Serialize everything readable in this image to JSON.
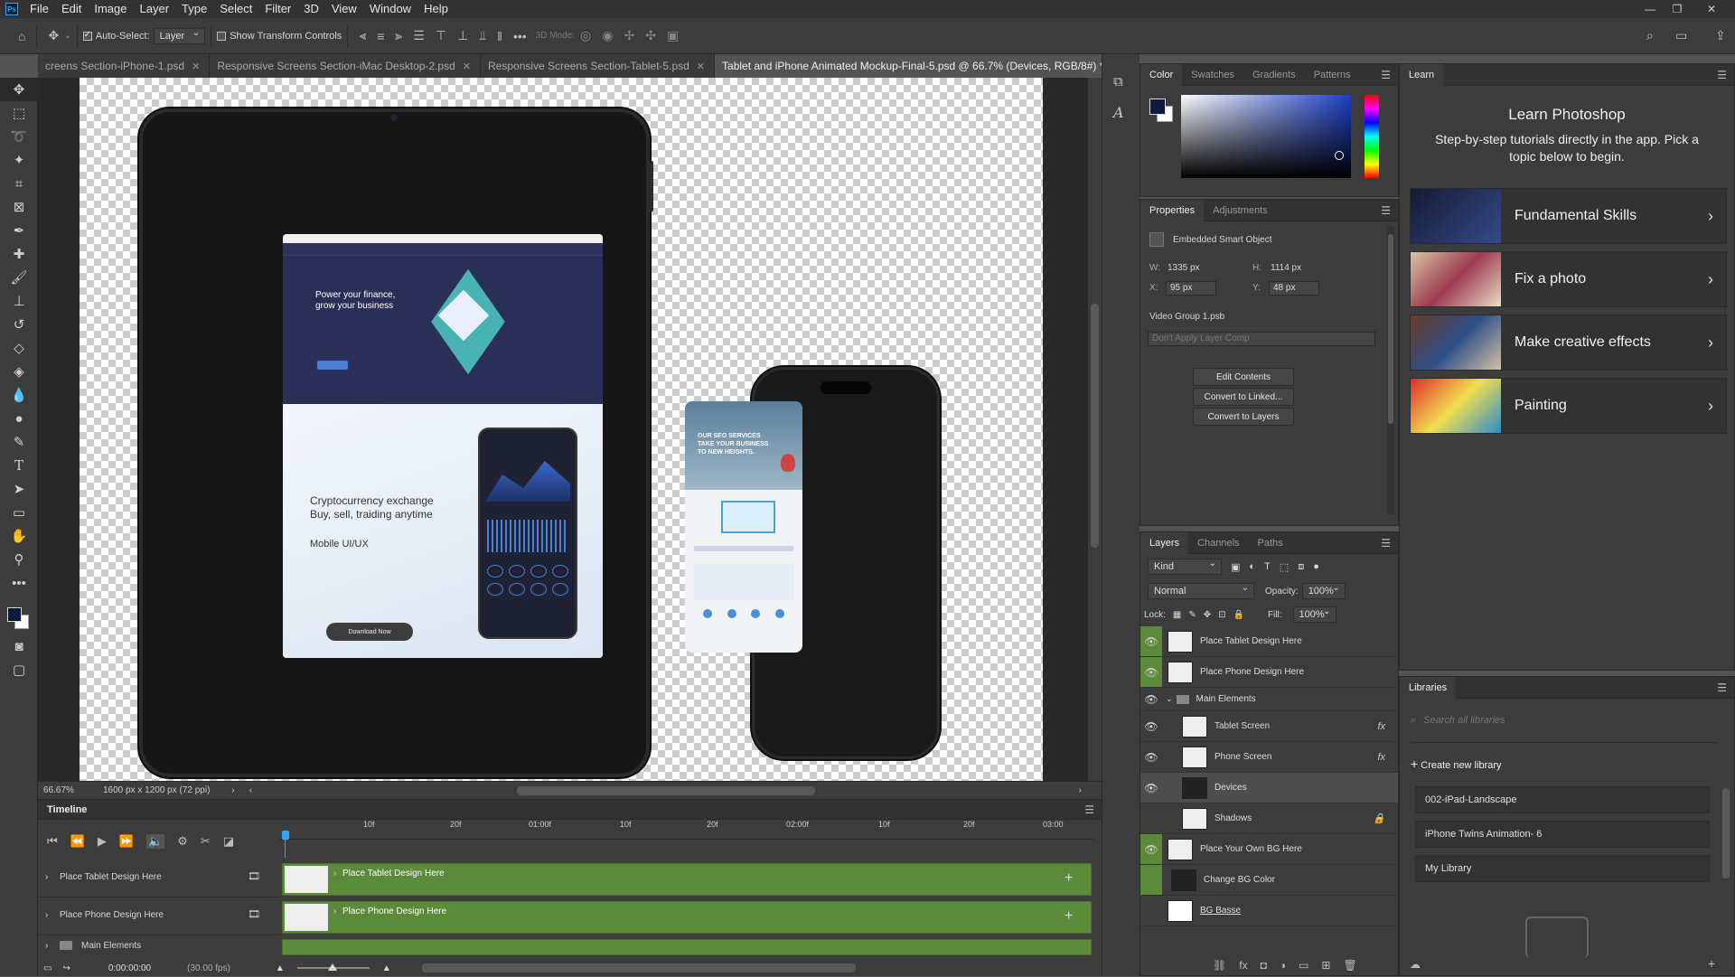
{
  "app": {
    "logo": "Ps"
  },
  "menu": [
    "File",
    "Edit",
    "Image",
    "Layer",
    "Type",
    "Select",
    "Filter",
    "3D",
    "View",
    "Window",
    "Help"
  ],
  "options": {
    "auto_select_label": "Auto-Select:",
    "auto_select_value": "Layer",
    "show_transform": "Show Transform Controls",
    "mode_3d": "3D Mode:"
  },
  "tabs": [
    {
      "label": "creens Section-iPhone-1.psd",
      "active": false
    },
    {
      "label": "Responsive Screens Section-iMac Desktop-2.psd",
      "active": false
    },
    {
      "label": "Responsive Screens Section-Tablet-5.psd",
      "active": false
    },
    {
      "label": "Tablet and iPhone Animated Mockup-Final-5.psd @ 66.7% (Devices, RGB/8#) *",
      "active": true
    }
  ],
  "tablet_site": {
    "hero_line1": "Power your finance,",
    "hero_line2": "grow your business",
    "crypto_line1": "Cryptocurrency exchange",
    "crypto_line2": "Buy, sell, traiding anytime",
    "app_sub": "Mobile UI/UX",
    "download": "Download Now"
  },
  "phone_site": {
    "line1": "OUR SEO SERVICES",
    "line2": "TAKE YOUR BUSINESS",
    "line3": "TO NEW HEIGHTS."
  },
  "status": {
    "zoom": "66.67%",
    "doc_info": "1600 px x 1200 px (72 ppi)"
  },
  "timeline": {
    "title": "Timeline",
    "ruler": [
      "10f",
      "20f",
      "01:00f",
      "10f",
      "20f",
      "02:00f",
      "10f",
      "20f",
      "03:00"
    ],
    "tracks": [
      {
        "label": "Place Tablet Design Here",
        "clip": "Place Tablet Design Here"
      },
      {
        "label": "Place Phone Design Here",
        "clip": "Place Phone Design Here"
      }
    ],
    "group": "Main Elements",
    "time": "0:00:00:00",
    "fps": "(30.00 fps)"
  },
  "color_panel": {
    "tabs": [
      "Color",
      "Swatches",
      "Gradients",
      "Patterns"
    ],
    "fg": "#0d1b3e",
    "bg": "#ffffff"
  },
  "properties": {
    "tabs": [
      "Properties",
      "Adjustments"
    ],
    "type": "Embedded Smart Object",
    "w_label": "W:",
    "w": "1335 px",
    "h_label": "H:",
    "h": "1114 px",
    "x_label": "X:",
    "x": "95 px",
    "y_label": "Y:",
    "y": "48 px",
    "file": "Video Group 1.psb",
    "layer_comp": "Don't Apply Layer Comp",
    "buttons": [
      "Edit Contents",
      "Convert to Linked...",
      "Convert to Layers"
    ]
  },
  "layers_panel": {
    "tabs": [
      "Layers",
      "Channels",
      "Paths"
    ],
    "kind": "Kind",
    "blend": "Normal",
    "opacity_label": "Opacity:",
    "opacity": "100%",
    "lock_label": "Lock:",
    "fill_label": "Fill:",
    "fill": "100%",
    "layers": [
      {
        "name": "Place Tablet Design Here",
        "eye": true,
        "fx": false
      },
      {
        "name": "Place Phone Design Here",
        "eye": true,
        "fx": false
      },
      {
        "name": "Main Elements",
        "eye": false,
        "fx": false
      },
      {
        "name": "Tablet Screen",
        "eye": false,
        "fx": true
      },
      {
        "name": "Phone Screen",
        "eye": false,
        "fx": true
      },
      {
        "name": "Devices",
        "eye": false,
        "fx": false
      },
      {
        "name": "Shadows",
        "eye": false,
        "fx": false
      },
      {
        "name": "Place Your Own BG Here",
        "eye": true,
        "fx": false
      },
      {
        "name": "Change BG Color",
        "eye": false,
        "fx": false
      },
      {
        "name": "BG Basse",
        "eye": false,
        "fx": false
      }
    ]
  },
  "learn": {
    "tab": "Learn",
    "title": "Learn Photoshop",
    "subtitle": "Step-by-step tutorials directly in the app. Pick a topic below to begin.",
    "cards": [
      "Fundamental Skills",
      "Fix a photo",
      "Make creative effects",
      "Painting"
    ]
  },
  "libraries": {
    "tab": "Libraries",
    "search_placeholder": "Search all libraries",
    "create": "Create new library",
    "items": [
      "002-iPad-Landscape",
      "iPhone Twins Animation- 6",
      "My Library"
    ]
  }
}
